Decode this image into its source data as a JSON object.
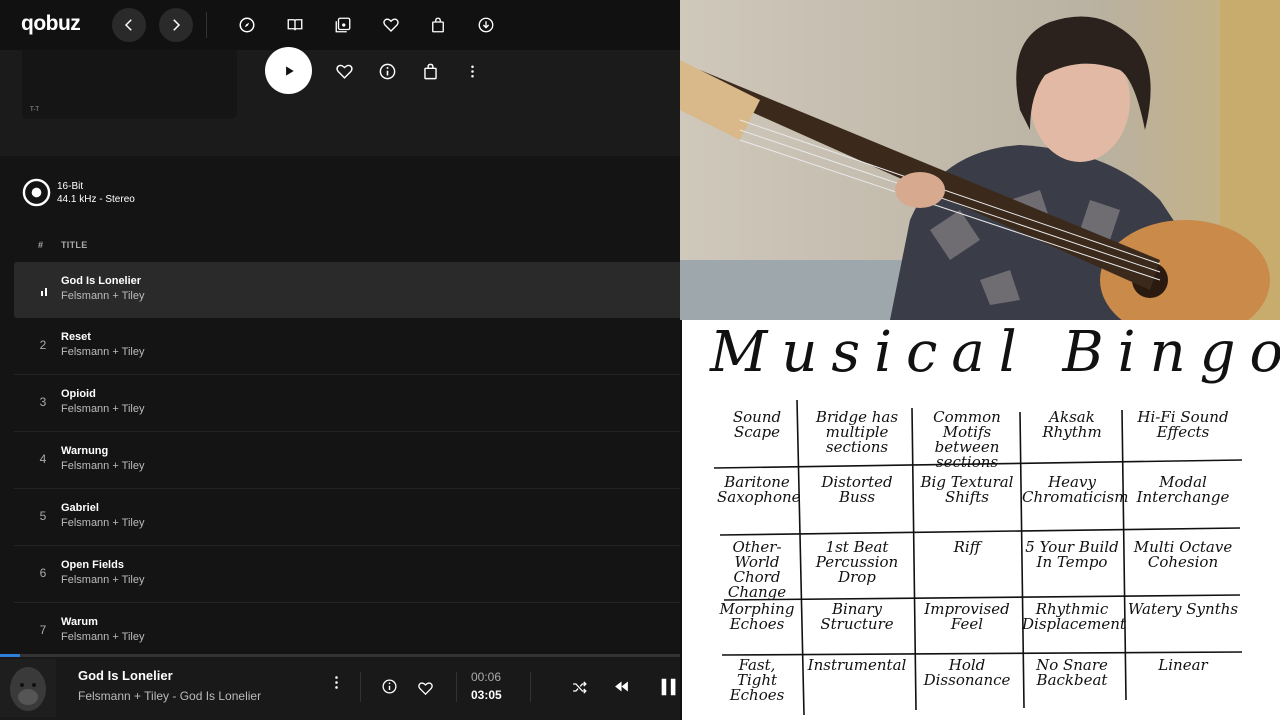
{
  "app": {
    "logo": "qobuz"
  },
  "album": {
    "cover_caption": "T-T"
  },
  "quality": {
    "bit_depth": "16-Bit",
    "format": "44.1 kHz - Stereo"
  },
  "tracklist": {
    "header_num": "#",
    "header_title": "TITLE",
    "tracks": [
      {
        "num": "",
        "title": "God Is Lonelier",
        "artist": "Felsmann + Tiley"
      },
      {
        "num": "2",
        "title": "Reset",
        "artist": "Felsmann + Tiley"
      },
      {
        "num": "3",
        "title": "Opioid",
        "artist": "Felsmann + Tiley"
      },
      {
        "num": "4",
        "title": "Warnung",
        "artist": "Felsmann + Tiley"
      },
      {
        "num": "5",
        "title": "Gabriel",
        "artist": "Felsmann + Tiley"
      },
      {
        "num": "6",
        "title": "Open Fields",
        "artist": "Felsmann + Tiley"
      },
      {
        "num": "7",
        "title": "Warum",
        "artist": "Felsmann + Tiley"
      }
    ]
  },
  "player": {
    "title": "God Is Lonelier",
    "subtitle": "Felsmann + Tiley - God Is Lonelier",
    "elapsed": "00:06",
    "duration": "03:05",
    "progress_fraction": 0.03,
    "accent": "#2d7fd7"
  },
  "whiteboard": {
    "title": "Musical Bingo!!",
    "cells": [
      [
        "Sound Scape",
        "Bridge has multiple sections",
        "Common Motifs between sections",
        "Aksak Rhythm",
        "Hi-Fi Sound Effects"
      ],
      [
        "Baritone Saxophone",
        "Distorted Buss",
        "Big Textural Shifts",
        "Heavy Chromaticism",
        "Modal Interchange"
      ],
      [
        "Other-World Chord Change",
        "1st Beat Percussion Drop",
        "Riff",
        "5 Your Build In Tempo",
        "Multi Octave Cohesion"
      ],
      [
        "Morphing Echoes",
        "Binary Structure",
        "Improvised Feel",
        "Rhythmic Displacement",
        "Watery Synths"
      ],
      [
        "Fast, Tight Echoes",
        "Instrumental",
        "Hold Dissonance",
        "No Snare Backbeat",
        "Linear"
      ]
    ]
  }
}
